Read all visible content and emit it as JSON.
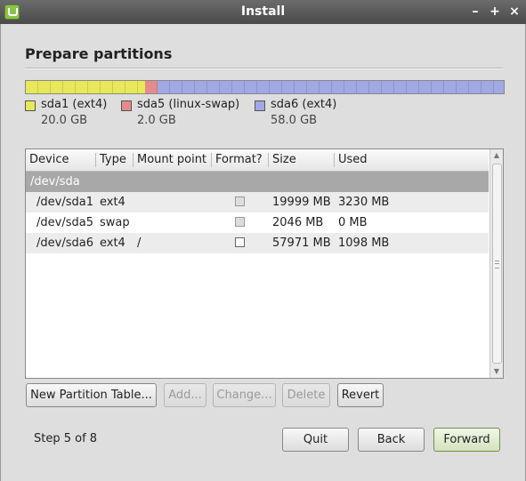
{
  "window": {
    "title": "Install",
    "controls": [
      "–",
      "+",
      "×"
    ]
  },
  "page": {
    "heading": "Prepare partitions"
  },
  "partition_bar": [
    {
      "name": "sda1 (ext4)",
      "size": "20.0 GB",
      "color": "#e7e85a",
      "fraction": 0.25
    },
    {
      "name": "sda5 (linux-swap)",
      "size": "2.0 GB",
      "color": "#e58b8b",
      "fraction": 0.025
    },
    {
      "name": "sda6 (ext4)",
      "size": "58.0 GB",
      "color": "#a1a8e4",
      "fraction": 0.725
    }
  ],
  "table": {
    "columns": [
      "Device",
      "Type",
      "Mount point",
      "Format?",
      "Size",
      "Used"
    ],
    "group": "/dev/sda",
    "rows": [
      {
        "device": "/dev/sda1",
        "type": "ext4",
        "mount": "",
        "format": false,
        "format_enabled": false,
        "size": "19999 MB",
        "used": "3230 MB"
      },
      {
        "device": "/dev/sda5",
        "type": "swap",
        "mount": "",
        "format": false,
        "format_enabled": false,
        "size": "2046 MB",
        "used": "0 MB"
      },
      {
        "device": "/dev/sda6",
        "type": "ext4",
        "mount": "/",
        "format": false,
        "format_enabled": true,
        "size": "57971 MB",
        "used": "1098 MB"
      }
    ]
  },
  "buttons": {
    "new_partition_table": "New Partition Table...",
    "add": "Add...",
    "change": "Change...",
    "delete": "Delete",
    "revert": "Revert",
    "quit": "Quit",
    "back": "Back",
    "forward": "Forward"
  },
  "footer": {
    "step": "Step 5 of 8"
  }
}
